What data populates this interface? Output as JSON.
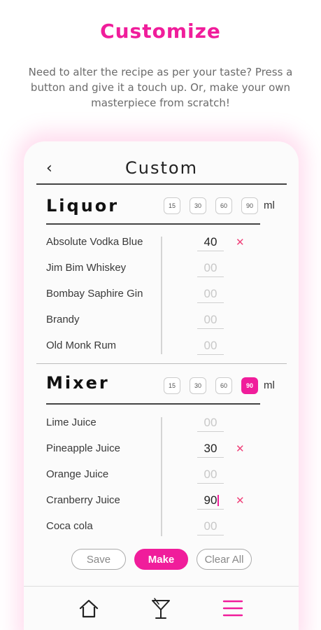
{
  "hero": {
    "title": "Customize",
    "description": "Need to alter the recipe as per your taste? Press a button and give it a touch up. Or, make your own masterpiece from scratch!"
  },
  "header": {
    "title": "Custom",
    "back_icon": "chevron-left-icon"
  },
  "liquor": {
    "title": "Liquor",
    "amounts": [
      "15",
      "30",
      "60",
      "90"
    ],
    "selected_amount": null,
    "unit": "ml",
    "items": [
      {
        "name": "Absolute Vodka Blue",
        "value": "40",
        "placeholder": "00"
      },
      {
        "name": "Jim Bim Whiskey",
        "value": "",
        "placeholder": "00"
      },
      {
        "name": "Bombay Saphire Gin",
        "value": "",
        "placeholder": "00"
      },
      {
        "name": "Brandy",
        "value": "",
        "placeholder": "00"
      },
      {
        "name": "Old Monk Rum",
        "value": "",
        "placeholder": "00"
      }
    ]
  },
  "mixer": {
    "title": "Mixer",
    "amounts": [
      "15",
      "30",
      "60",
      "90"
    ],
    "selected_amount": "90",
    "unit": "ml",
    "items": [
      {
        "name": "Lime Juice",
        "value": "",
        "placeholder": "00"
      },
      {
        "name": "Pineapple Juice",
        "value": "30",
        "placeholder": "00"
      },
      {
        "name": "Orange Juice",
        "value": "",
        "placeholder": "00"
      },
      {
        "name": "Cranberry Juice",
        "value": "90",
        "placeholder": "00"
      },
      {
        "name": "Coca cola",
        "value": "",
        "placeholder": "00"
      }
    ]
  },
  "actions": {
    "save": "Save",
    "make": "Make",
    "clear": "Clear All"
  },
  "remove_symbol": "✕",
  "tabbar": {
    "icons": [
      "home-icon",
      "cocktail-glass-icon",
      "menu-icon"
    ],
    "active_color": "#f01d9b"
  },
  "colors": {
    "accent": "#f01d9b",
    "remove": "#f0427a"
  }
}
